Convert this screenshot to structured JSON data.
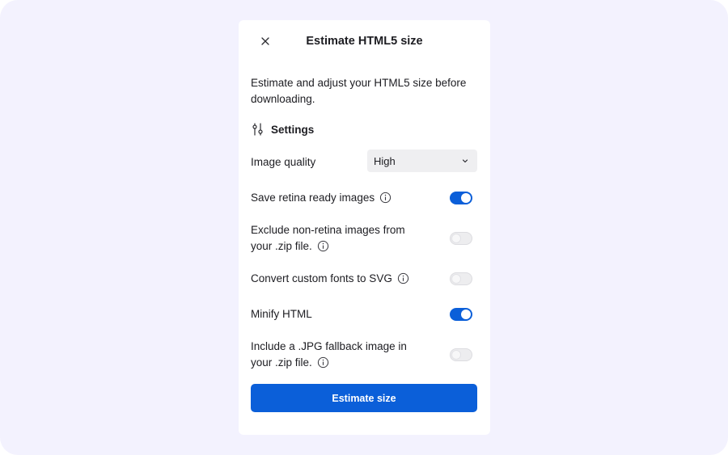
{
  "dialog": {
    "title": "Estimate HTML5 size",
    "description": "Estimate and adjust your HTML5 size before downloading."
  },
  "settings": {
    "heading": "Settings",
    "image_quality": {
      "label": "Image quality",
      "selected": "High"
    },
    "options": [
      {
        "label": "Save retina ready images",
        "enabled": true
      },
      {
        "label_line1": "Exclude non-retina images from",
        "label_line2": "your .zip file.",
        "enabled": false
      },
      {
        "label": "Convert custom fonts to SVG",
        "enabled": false
      },
      {
        "label": "Minify HTML",
        "enabled": true
      },
      {
        "label_line1": "Include a .JPG fallback image in",
        "label_line2": "your .zip file.",
        "enabled": false
      }
    ]
  },
  "actions": {
    "estimate_label": "Estimate size"
  },
  "colors": {
    "accent": "#0b5fd9",
    "background": "#f3f2fe",
    "panel": "#ffffff",
    "text": "#1d1d22"
  },
  "icons": {
    "close": "close-icon",
    "settings": "sliders-icon",
    "info": "info-icon",
    "dropdown": "chevron-down-icon"
  }
}
